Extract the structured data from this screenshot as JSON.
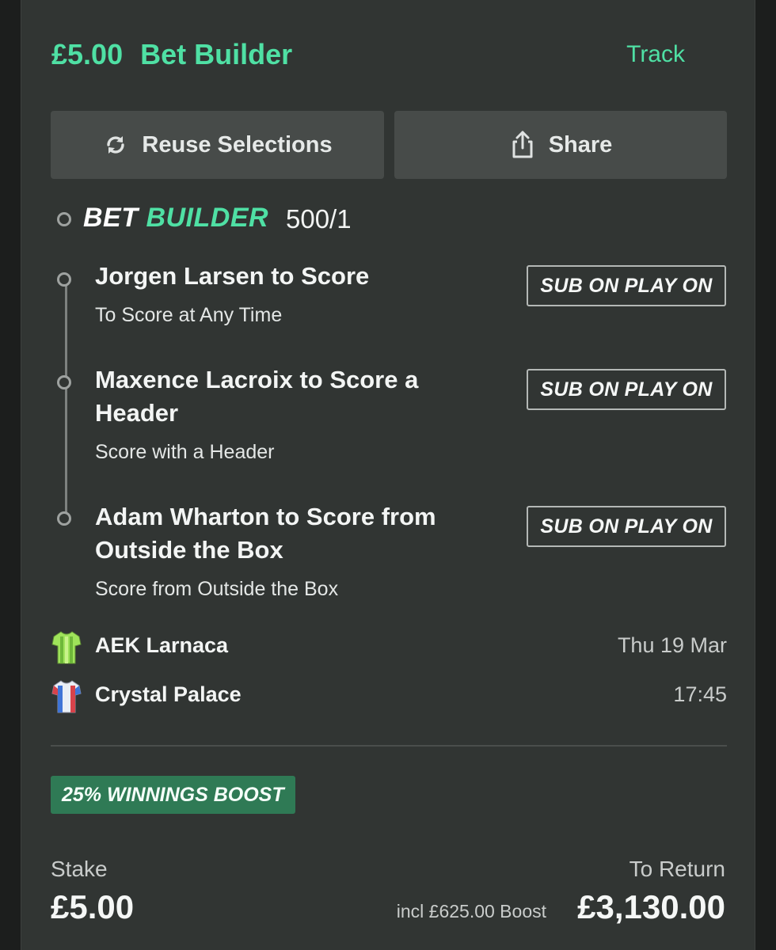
{
  "header": {
    "stake": "£5.00",
    "bet_type": "Bet Builder",
    "track_label": "Track"
  },
  "actions": {
    "reuse_label": "Reuse Selections",
    "share_label": "Share"
  },
  "bet_builder": {
    "label_part1": "BET",
    "label_part2": "BUILDER",
    "odds": "500/1"
  },
  "legs": [
    {
      "title_line1": "Jorgen Larsen to Score",
      "title_line2": "",
      "market": "To Score at Any Time",
      "badge": "SUB ON PLAY ON"
    },
    {
      "title_line1": "Maxence Lacroix to Score a",
      "title_line2": "Header",
      "market": "Score with a Header",
      "badge": "SUB ON PLAY ON"
    },
    {
      "title_line1": "Adam Wharton to Score from",
      "title_line2": "Outside the Box",
      "market": "Score from Outside the Box",
      "badge": "SUB ON PLAY ON"
    }
  ],
  "event": {
    "home_team": "AEK Larnaca",
    "away_team": "Crystal Palace",
    "date": "Thu 19 Mar",
    "time": "17:45"
  },
  "promo": {
    "boost_badge": "25% WINNINGS BOOST"
  },
  "summary": {
    "stake_label": "Stake",
    "stake_value": "£5.00",
    "return_label": "To Return",
    "boost_note": "incl £625.00 Boost",
    "return_value": "£3,130.00"
  },
  "colors": {
    "accent_green": "#4fe0a4",
    "boost_badge_bg": "#2f7a55",
    "card_bg": "#313533",
    "button_bg": "#474b49"
  },
  "icons": {
    "reuse": "refresh-icon",
    "share": "share-icon",
    "home_kit": "green-shirt-icon",
    "away_kit": "red-blue-shirt-icon"
  }
}
